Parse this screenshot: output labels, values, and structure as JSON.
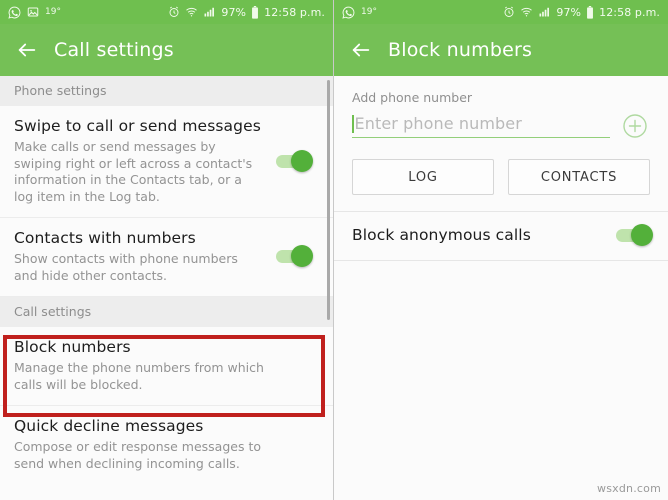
{
  "status_bar": {
    "temperature": "19°",
    "battery_percent": "97%",
    "time": "12:58 p.m.",
    "icons_left": [
      "whatsapp-icon",
      "image-icon"
    ],
    "icons_right": [
      "alarm-icon",
      "wifi-icon",
      "signal-icon",
      "battery-icon"
    ]
  },
  "colors": {
    "app_bar_green": "#75c056",
    "status_bar_green": "#6fbf4f",
    "toggle_on": "#53b03a",
    "toggle_track": "#bfe3ac",
    "highlight_red": "#c0201d",
    "underline_green": "#93cf7a"
  },
  "left_screen": {
    "title": "Call settings",
    "back_icon": "back-arrow-icon",
    "sections": [
      {
        "header": "Phone settings",
        "items": [
          {
            "title": "Swipe to call or send messages",
            "subtitle": "Make calls or send messages by swiping right or left across a contact's information in the Contacts tab, or a log item in the Log tab.",
            "control": "toggle",
            "toggle_on": true
          },
          {
            "title": "Contacts with numbers",
            "subtitle": "Show contacts with phone numbers and hide other contacts.",
            "control": "toggle",
            "toggle_on": true
          }
        ]
      },
      {
        "header": "Call settings",
        "items": [
          {
            "title": "Block numbers",
            "subtitle": "Manage the phone numbers from which calls will be blocked.",
            "control": "none",
            "highlighted": true
          },
          {
            "title": "Quick decline messages",
            "subtitle": "Compose or edit response messages to send when declining incoming calls.",
            "control": "none"
          }
        ]
      }
    ]
  },
  "right_screen": {
    "title": "Block numbers",
    "back_icon": "back-arrow-icon",
    "add_number": {
      "label": "Add phone number",
      "placeholder": "Enter phone number",
      "value": "",
      "add_icon": "plus-circle-icon"
    },
    "buttons": [
      {
        "label": "LOG"
      },
      {
        "label": "CONTACTS"
      }
    ],
    "block_anonymous": {
      "label": "Block anonymous calls",
      "toggle_on": true
    }
  },
  "watermark": "wsxdn.com"
}
